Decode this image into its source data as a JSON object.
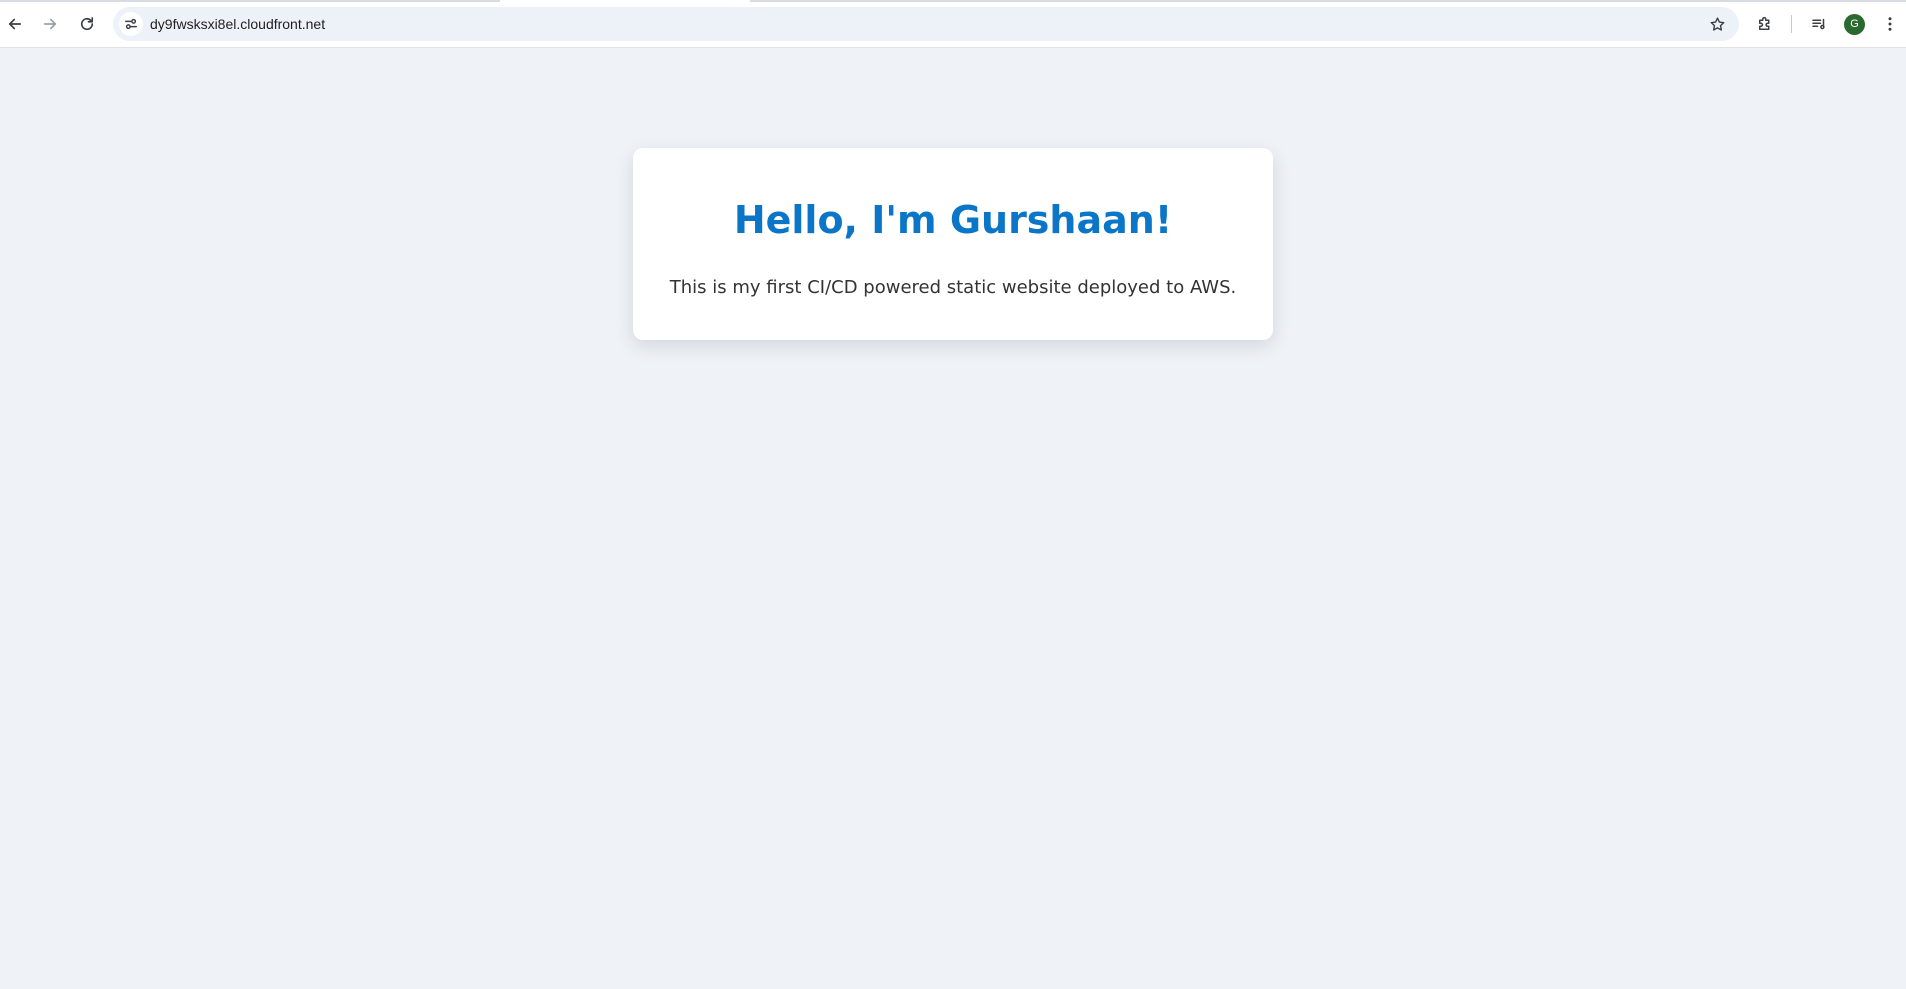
{
  "browser": {
    "url": "dy9fwsksxi8el.cloudfront.net",
    "profile_initial": "G",
    "icons": {
      "back": "arrow-left-icon",
      "forward": "arrow-right-icon",
      "reload": "reload-icon",
      "site_info": "tune-icon",
      "bookmark": "star-icon",
      "extensions": "puzzle-icon",
      "media": "media-controls-icon",
      "menu": "kebab-menu-icon"
    }
  },
  "page": {
    "heading": "Hello, I'm Gurshaan!",
    "description": "This is my first CI/CD powered static website deployed to AWS."
  },
  "colors": {
    "page_background": "#eff2f6",
    "heading": "#0b76c8",
    "text": "#333333",
    "card": "#ffffff",
    "avatar": "#2a6a2f"
  }
}
